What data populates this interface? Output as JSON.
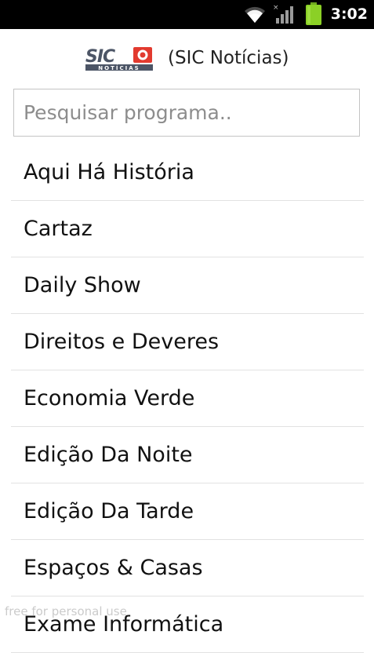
{
  "status_bar": {
    "time": "3:02",
    "icons": [
      "wifi-icon",
      "signal-icon",
      "battery-icon"
    ],
    "background": "#000000",
    "battery_color": "#8bd026"
  },
  "header": {
    "logo_text": "SIC",
    "logo_subtext": "NOTÍCIAS",
    "title": "(SIC Notícias)",
    "logo_color": "#e23a2f"
  },
  "search": {
    "placeholder": "Pesquisar programa..",
    "value": ""
  },
  "programs": [
    "Aqui Há História",
    "Cartaz",
    "Daily Show",
    "Direitos e Deveres",
    "Economia Verde",
    "Edição Da Noite",
    "Edição Da Tarde",
    "Espaços & Casas",
    "Exame Informática"
  ],
  "watermark": "free for personal use"
}
